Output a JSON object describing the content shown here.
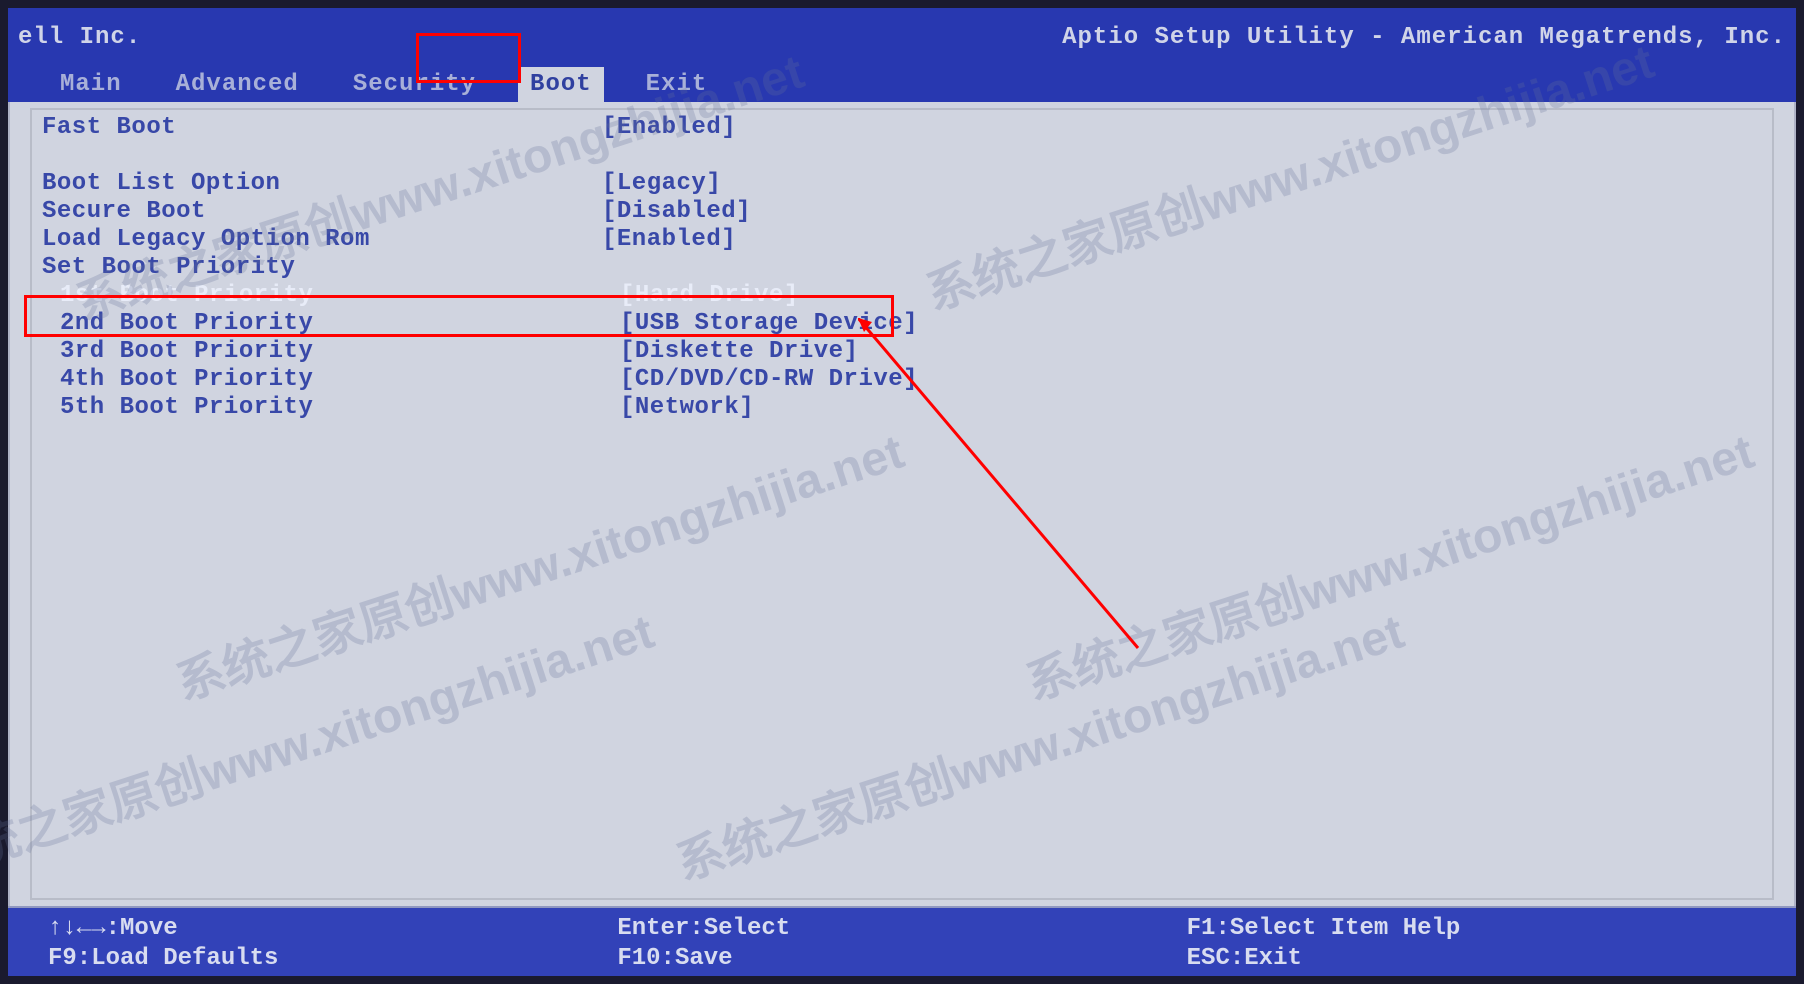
{
  "header": {
    "left": "ell Inc.",
    "right": "Aptio Setup Utility - American Megatrends, Inc."
  },
  "tabs": [
    {
      "label": "Main",
      "active": false
    },
    {
      "label": "Advanced",
      "active": false
    },
    {
      "label": "Security",
      "active": false
    },
    {
      "label": "Boot",
      "active": true
    },
    {
      "label": "Exit",
      "active": false
    }
  ],
  "options": [
    {
      "label": "Fast Boot",
      "value": "[Enabled]",
      "indent": false,
      "selected": false
    },
    {
      "label": "",
      "value": "",
      "indent": false,
      "selected": false,
      "spacer": true
    },
    {
      "label": "Boot List Option",
      "value": "[Legacy]",
      "indent": false,
      "selected": false
    },
    {
      "label": "Secure Boot",
      "value": "[Disabled]",
      "indent": false,
      "selected": false
    },
    {
      "label": "Load Legacy Option Rom",
      "value": "[Enabled]",
      "indent": false,
      "selected": false
    },
    {
      "label": "Set Boot Priority",
      "value": "",
      "indent": false,
      "selected": false
    },
    {
      "label": "1st Boot Priority",
      "value": "[Hard Drive]",
      "indent": true,
      "selected": true
    },
    {
      "label": "2nd Boot Priority",
      "value": "[USB Storage Device]",
      "indent": true,
      "selected": false
    },
    {
      "label": "3rd Boot Priority",
      "value": "[Diskette Drive]",
      "indent": true,
      "selected": false
    },
    {
      "label": "4th Boot Priority",
      "value": "[CD/DVD/CD-RW Drive]",
      "indent": true,
      "selected": false
    },
    {
      "label": "5th Boot Priority",
      "value": "[Network]",
      "indent": true,
      "selected": false
    }
  ],
  "footer": {
    "row1": {
      "c1": "↑↓←→:Move",
      "c2": "Enter:Select",
      "c3": "F1:Select Item Help"
    },
    "row2": {
      "c1": "F9:Load Defaults",
      "c2": "F10:Save",
      "c3": "ESC:Exit"
    }
  },
  "watermark_text": "系统之家原创www.xitongzhijia.net"
}
